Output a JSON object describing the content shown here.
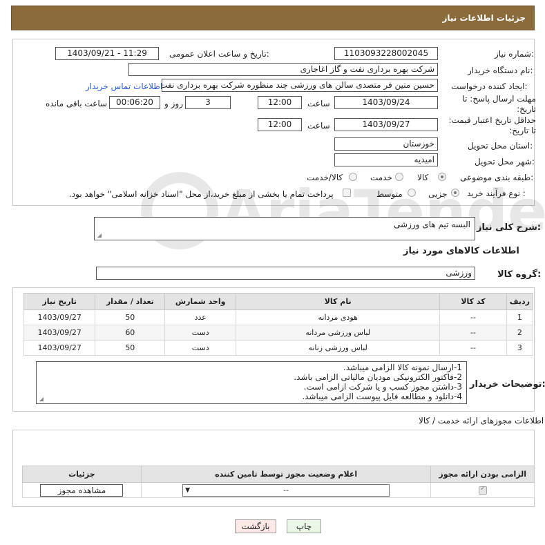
{
  "header": {
    "title": "جزئیات اطلاعات نیاز"
  },
  "fields": {
    "need_number_label": "شماره نیاز:",
    "need_number": "1103093228002045",
    "announce_label": "تاریخ و ساعت اعلان عمومی:",
    "announce_value": "1403/09/21 - 11:29",
    "buyer_org_label": "نام دستگاه خریدار:",
    "buyer_org": "شرکت بهره برداری نفت و گاز اغاجاری",
    "creator_label": "ایجاد کننده درخواست:",
    "creator": "حسین متین فر متصدی سالن های ورزشی چند منظوره شرکت بهره برداری نفت",
    "contact_link": "اطلاعات تماس خریدار",
    "deadline_label": "مهلت ارسال پاسخ: تا تاریخ:",
    "deadline_date": "1403/09/24",
    "hour_label": "ساعت",
    "deadline_time": "12:00",
    "days_value": "3",
    "days_label": "روز و",
    "remaining_time": "00:06:20",
    "remaining_label": "ساعت باقی مانده",
    "validity_label": "حداقل تاریخ اعتبار قیمت: تا تاریخ:",
    "validity_date": "1403/09/27",
    "validity_time": "12:00",
    "province_label": "استان محل تحویل:",
    "province": "خوزستان",
    "city_label": "شهر محل تحویل:",
    "city": "امیدیه",
    "category_label": "طبقه بندی موضوعی:",
    "category_options": [
      "کالا",
      "خدمت",
      "کالا/خدمت"
    ],
    "process_label": "نوع فرآیند خرید :",
    "process_options": [
      "جزیی",
      "متوسط"
    ],
    "payment_note": "پرداخت تمام یا بخشی از مبلغ خرید،از محل \"اسناد خزانه اسلامی\" خواهد بود."
  },
  "summary": {
    "label": "شرح کلی نیاز:",
    "value": "البسه  تیم های ورزشی"
  },
  "goods": {
    "section_title": "اطلاعات کالاهای مورد نیاز",
    "group_label": "گروه کالا:",
    "group_value": "ورزشی",
    "columns": [
      "ردیف",
      "کد کالا",
      "نام کالا",
      "واحد شمارش",
      "تعداد / مقدار",
      "تاریخ نیاز"
    ],
    "rows": [
      {
        "idx": "1",
        "code": "--",
        "name": "هودی مردانه",
        "unit": "عدد",
        "qty": "50",
        "date": "1403/09/27"
      },
      {
        "idx": "2",
        "code": "--",
        "name": "لباس ورزشی مردانه",
        "unit": "دست",
        "qty": "60",
        "date": "1403/09/27"
      },
      {
        "idx": "3",
        "code": "--",
        "name": "لباس ورزشی زنانه",
        "unit": "دست",
        "qty": "50",
        "date": "1403/09/27"
      }
    ]
  },
  "buyer_notes": {
    "label": "توضیحات خریدار:",
    "lines": [
      "1-ارسال نمونه کالا الزامی میباشد.",
      "2-فاکتور الکترونیکی مودیان مالیاتی الزامی باشد.",
      "3-داشتن مجوز کسب و یا شرکت ازامی است.",
      "4-دانلود و مطالعه فایل پیوست الزامی میباشد."
    ]
  },
  "permits": {
    "section_title": "اطلاعات مجوزهای ارائه خدمت / کالا",
    "columns": [
      "الزامی بودن ارائه مجوز",
      "اعلام وضعیت مجوز توسط تامین کننده",
      "جزئیات"
    ],
    "status_value": "--",
    "view_button": "مشاهده مجوز"
  },
  "footer": {
    "print_button": "چاپ",
    "back_button": "بازگشت"
  },
  "watermark": {
    "text": "AriaTender.neT"
  }
}
